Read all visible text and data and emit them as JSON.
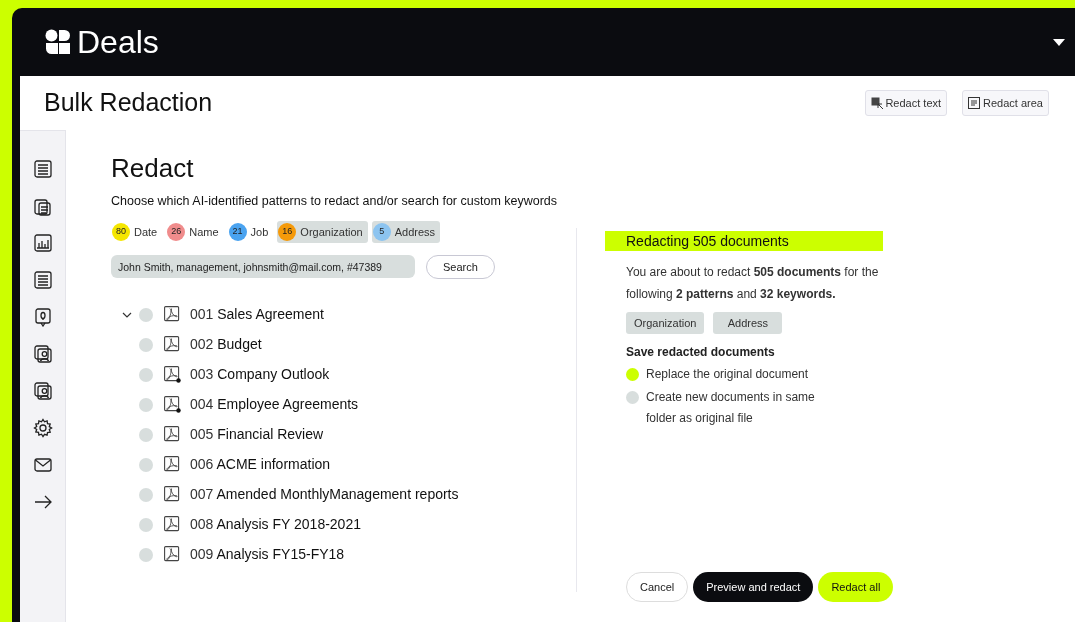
{
  "app": {
    "title": "Deals"
  },
  "page": {
    "title": "Bulk Redaction"
  },
  "toolbar": [
    {
      "kind": "text",
      "label": "Redact text"
    },
    {
      "kind": "area",
      "label": "Redact area"
    }
  ],
  "redact": {
    "title": "Redact",
    "subtitle": "Choose which AI-identified patterns to redact and/or search for custom keywords",
    "patterns": [
      {
        "count": "80",
        "label": "Date",
        "color": "#f5e600",
        "selected": false
      },
      {
        "count": "26",
        "label": "Name",
        "color": "#f08c8c",
        "selected": false
      },
      {
        "count": "21",
        "label": "Job",
        "color": "#4aa3f0",
        "selected": false
      },
      {
        "count": "16",
        "label": "Organization",
        "color": "#f59a0a",
        "selected": true
      },
      {
        "count": "5",
        "label": "Address",
        "color": "#8cc4f0",
        "selected": true
      }
    ],
    "search": {
      "value": "John Smith, management, johnsmith@mail.com, #47389",
      "button": "Search"
    },
    "documents": [
      {
        "number": "001",
        "name": "Sales Agreement",
        "checked": false,
        "marked": false,
        "expanded": true
      },
      {
        "number": "002",
        "name": "Budget",
        "checked": false,
        "marked": false
      },
      {
        "number": "003",
        "name": "Company Outlook",
        "checked": false,
        "marked": true
      },
      {
        "number": "004",
        "name": "Employee Agreements",
        "checked": false,
        "marked": true
      },
      {
        "number": "005",
        "name": "Financial Review",
        "checked": false,
        "marked": false
      },
      {
        "number": "006",
        "name": "ACME information",
        "checked": false,
        "marked": false
      },
      {
        "number": "007",
        "name": "Amended MonthlyManagement reports",
        "checked": false,
        "marked": false
      },
      {
        "number": "008",
        "name": "Analysis FY 2018-2021",
        "checked": false,
        "marked": false
      },
      {
        "number": "009",
        "name": "Analysis FY15-FY18",
        "checked": false,
        "marked": false
      }
    ]
  },
  "summary": {
    "title": "Redacting 505 documents",
    "text": "You are about to redact **505 documents** for the following **2 patterns** and **32 keywords.**",
    "tags": [
      "Organization",
      "Address"
    ],
    "save_title": "Save redacted documents",
    "options": [
      {
        "label": "Replace the original document",
        "selected": true
      },
      {
        "label": "Create new documents in same folder as original file",
        "selected": false
      }
    ]
  },
  "buttons": [
    {
      "kind": "outline",
      "label": "Cancel"
    },
    {
      "kind": "dark",
      "label": "Preview and redact"
    },
    {
      "kind": "accent",
      "label": "Redact all"
    }
  ]
}
